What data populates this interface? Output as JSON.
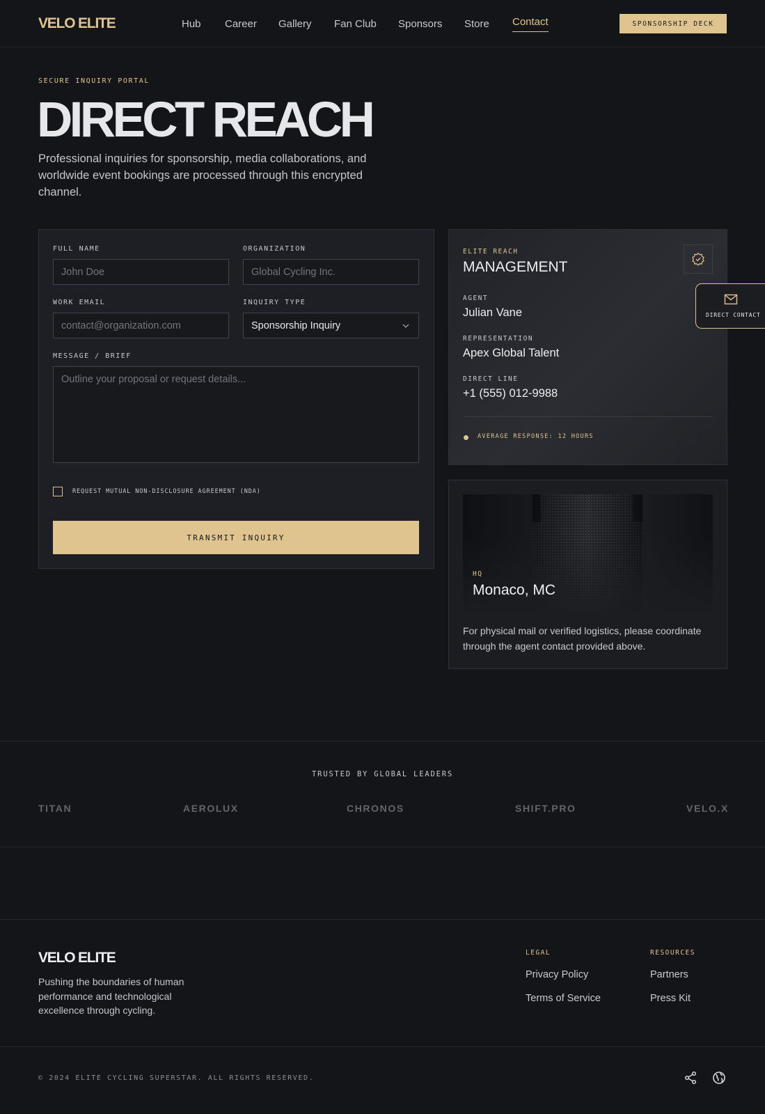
{
  "header": {
    "brand": "VELO ELITE",
    "nav": [
      "Hub",
      "Career",
      "Gallery",
      "Fan Club",
      "Sponsors",
      "Store",
      "Contact"
    ],
    "active_nav": "Contact",
    "cta": "SPONSORSHIP DECK"
  },
  "hero": {
    "eyebrow": "SECURE INQUIRY PORTAL",
    "title": "DIRECT REACH",
    "subtitle": "Professional inquiries for sponsorship, media collaborations, and worldwide event bookings are processed through this encrypted channel."
  },
  "form": {
    "full_name": {
      "label": "FULL NAME",
      "placeholder": "John Doe"
    },
    "organization": {
      "label": "ORGANIZATION",
      "placeholder": "Global Cycling Inc."
    },
    "work_email": {
      "label": "WORK EMAIL",
      "placeholder": "contact@organization.com"
    },
    "inquiry_type": {
      "label": "INQUIRY TYPE",
      "value": "Sponsorship Inquiry"
    },
    "message": {
      "label": "MESSAGE / BRIEF",
      "placeholder": "Outline your proposal or request details..."
    },
    "nda": {
      "label": "REQUEST MUTUAL NON-DISCLOSURE AGREEMENT (NDA)",
      "checked": false
    },
    "submit": "TRANSMIT INQUIRY"
  },
  "management": {
    "eyebrow": "ELITE REACH",
    "title": "MANAGEMENT",
    "agent_label": "AGENT",
    "agent": "Julian Vane",
    "rep_label": "REPRESENTATION",
    "rep": "Apex Global Talent",
    "line_label": "DIRECT LINE",
    "line": "+1 (555) 012-9988",
    "response": "AVERAGE RESPONSE: 12 HOURS",
    "icon": "verified-badge-icon"
  },
  "floating_contact": {
    "label": "DIRECT CONTACT",
    "icon": "mail-icon"
  },
  "hq": {
    "label": "HQ",
    "city": "Monaco, MC",
    "note": "For physical mail or verified logistics, please coordinate through the agent contact provided above."
  },
  "trusted": {
    "title": "TRUSTED BY GLOBAL LEADERS",
    "sponsors": [
      "TITAN",
      "AEROLUX",
      "CHRONOS",
      "SHIFT.PRO",
      "VELO.X"
    ]
  },
  "footer": {
    "brand": "VELO ELITE",
    "tagline": "Pushing the boundaries of human performance and technological excellence through cycling.",
    "legal_title": "LEGAL",
    "legal_links": [
      "Privacy Policy",
      "Terms of Service"
    ],
    "resources_title": "RESOURCES",
    "resources_links": [
      "Partners",
      "Press Kit"
    ],
    "copyright": "© 2024 ELITE CYCLING SUPERSTAR. ALL RIGHTS RESERVED.",
    "icons": [
      "share-icon",
      "globe-icon"
    ]
  },
  "colors": {
    "accent": "#e0c48f",
    "background": "#131519",
    "card": "#1d1f24"
  }
}
